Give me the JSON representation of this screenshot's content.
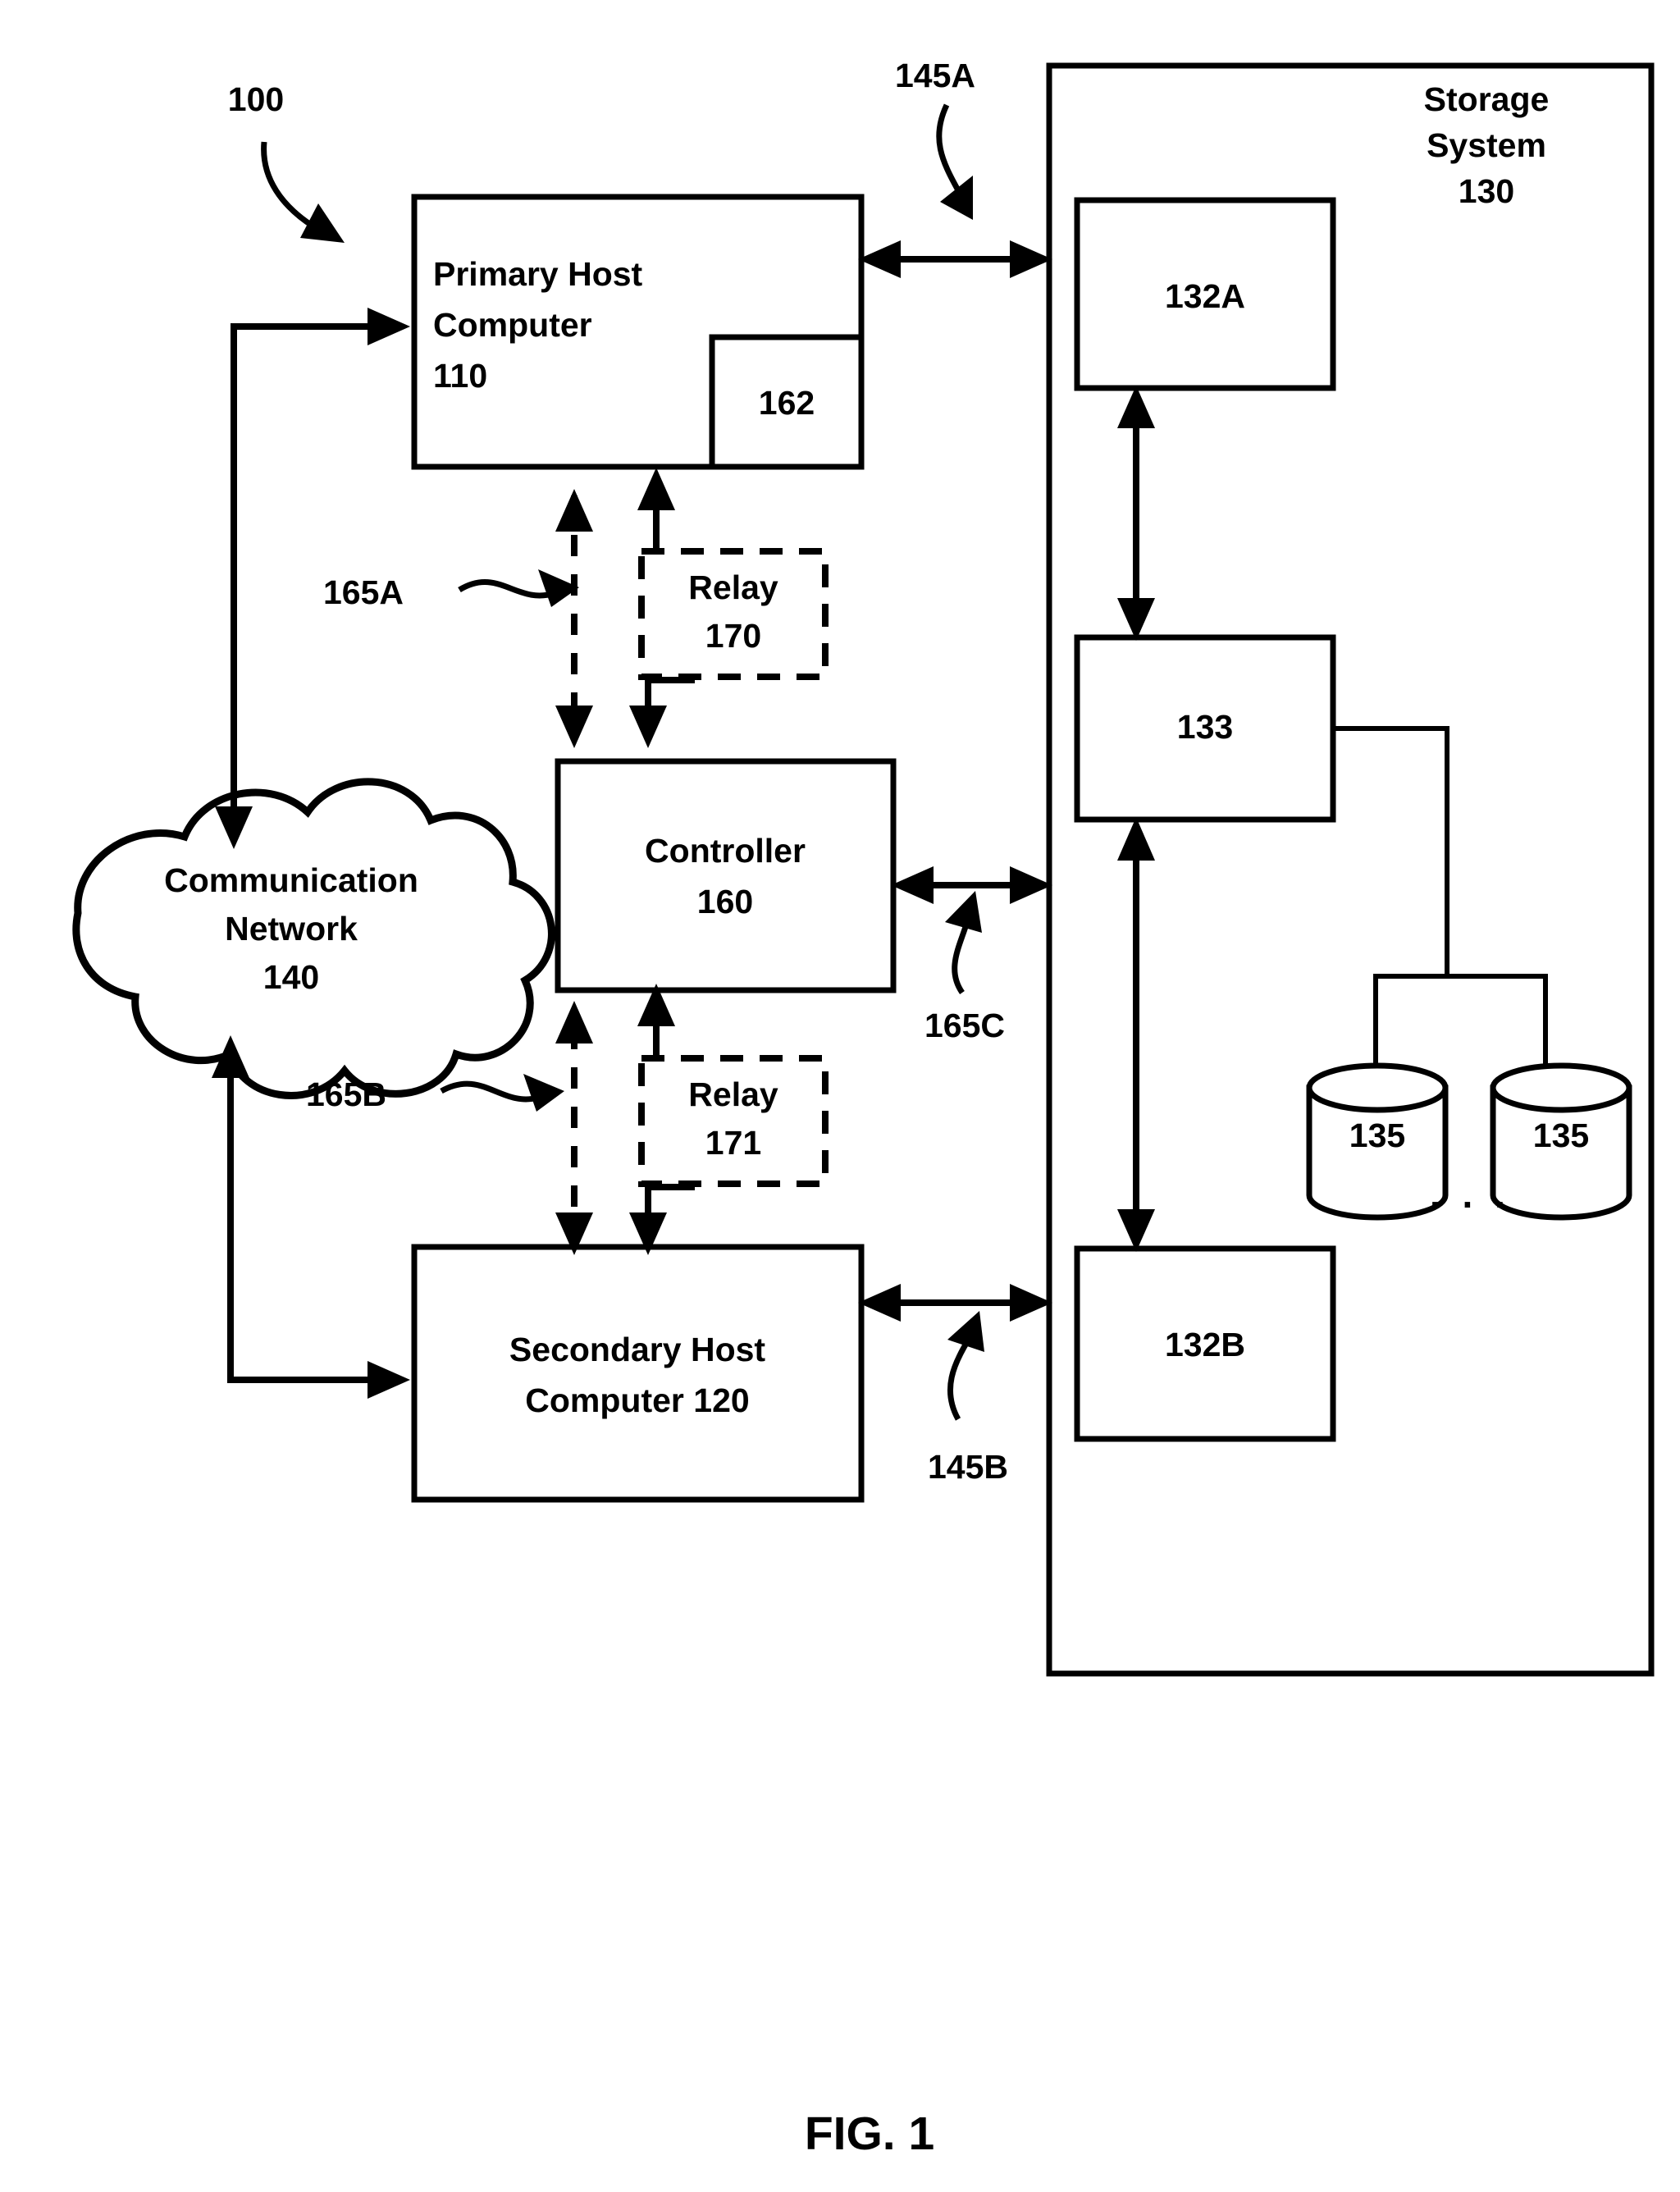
{
  "figure": {
    "caption": "FIG. 1",
    "system_ref": "100"
  },
  "nodes": {
    "primary_host": {
      "name": "Primary Host Computer",
      "line1": "Primary Host",
      "line2": "Computer",
      "ref": "110",
      "sub_module_ref": "162"
    },
    "secondary_host": {
      "line1": "Secondary Host",
      "line2": "Computer 120"
    },
    "controller": {
      "name": "Controller",
      "ref": "160"
    },
    "relay_top": {
      "name": "Relay",
      "ref": "170"
    },
    "relay_bottom": {
      "name": "Relay",
      "ref": "171"
    },
    "network": {
      "line1": "Communication",
      "line2": "Network",
      "ref": "140"
    },
    "storage_system": {
      "line1": "Storage",
      "line2": "System",
      "ref": "130"
    },
    "storage_132a": {
      "ref": "132A"
    },
    "storage_132b": {
      "ref": "132B"
    },
    "storage_133": {
      "ref": "133"
    },
    "disk_left": {
      "ref": "135"
    },
    "disk_right": {
      "ref": "135"
    },
    "disk_ellipsis": ". . ."
  },
  "connector_labels": {
    "host_storage_primary": "145A",
    "host_storage_secondary": "145B",
    "primary_controller": "165A",
    "secondary_controller": "165B",
    "controller_storage": "165C"
  },
  "colors": {
    "line": "#000000",
    "fill": "#ffffff",
    "text": "#000000"
  }
}
